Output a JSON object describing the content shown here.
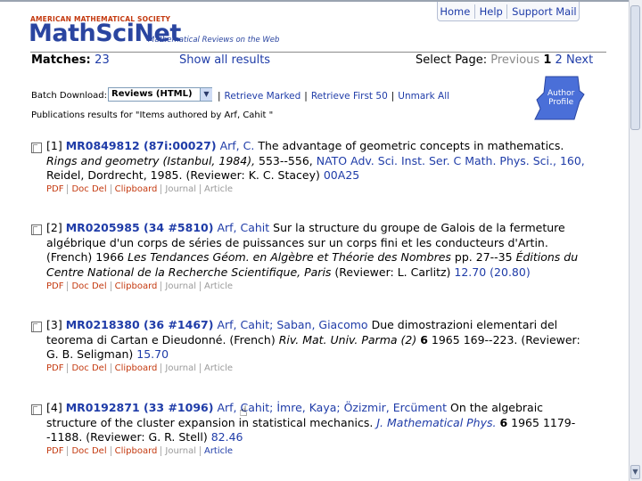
{
  "header": {
    "ams": "AMERICAN MATHEMATICAL SOCIETY",
    "logo": "MathSciNet",
    "tagline": "Mathematical Reviews on the Web",
    "nav": [
      "Home",
      "Help",
      "Support Mail"
    ]
  },
  "results": {
    "matches_label": "Matches:",
    "matches_count": "23",
    "show_all": "Show all results",
    "select_page_label": "Select Page:",
    "previous": "Previous",
    "page1": "1",
    "page2": "2",
    "next": "Next"
  },
  "batch": {
    "label": "Batch Download:",
    "selected": "Reviews (HTML)",
    "links": [
      "Retrieve Marked",
      "Retrieve First 50",
      "Unmark All"
    ],
    "publications_for": "Publications results for \"Items authored by Arf, Cahit \""
  },
  "profile": {
    "line1": "Author",
    "line2": "Profile"
  },
  "entries": [
    {
      "num": "[1]",
      "mr": "MR0849812 (87i:00027)",
      "authors": "Arf, C.",
      "title": "The advantage of geometric concepts in mathematics.",
      "venue": "Rings and geometry (Istanbul, 1984),",
      "pages": "553--556,",
      "series": "NATO Adv. Sci. Inst. Ser. C Math. Phys. Sci., 160,",
      "publisher": "Reidel, Dordrecht,",
      "year": "1985.",
      "reviewer": "(Reviewer: K. C. Stacey)",
      "msc": "00A25",
      "tools": [
        "PDF",
        "Doc Del",
        "Clipboard",
        "Journal",
        "Article"
      ]
    },
    {
      "num": "[2]",
      "mr": "MR0205985 (34 #5810)",
      "authors": "Arf, Cahit",
      "title": "Sur la structure du groupe de Galois de la fermeture algébrique d'un corps de séries de puissances sur un corps fini et les conducteurs d'Artin.",
      "lang": "(French)",
      "year": "1966",
      "venue": "Les Tendances Géom. en Algèbre et Théorie des Nombres",
      "pages": "pp. 27--35",
      "publisher": "Éditions du Centre National de la Recherche Scientifique, Paris",
      "reviewer": "(Reviewer: L. Carlitz)",
      "msc": "12.70 (20.80)",
      "tools": [
        "PDF",
        "Doc Del",
        "Clipboard",
        "Journal",
        "Article"
      ]
    },
    {
      "num": "[3]",
      "mr": "MR0218380 (36 #1467)",
      "authors": "Arf, Cahit; Saban, Giacomo",
      "title": "Due dimostrazioni elementari del teorema di Cartan e Dieudonné.",
      "lang": "(French)",
      "journal": "Riv. Mat. Univ. Parma (2)",
      "volume": "6",
      "year": "1965",
      "pages": "169--223.",
      "reviewer": "(Reviewer: G. B. Seligman)",
      "msc": "15.70",
      "tools": [
        "PDF",
        "Doc Del",
        "Clipboard",
        "Journal",
        "Article"
      ]
    },
    {
      "num": "[4]",
      "mr": "MR0192871 (33 #1096)",
      "authors": "Arf, Cahit; İmre, Kaya; Özizmir, Ercüment",
      "title": "On the algebraic structure of the cluster expansion in statistical mechanics.",
      "journal": "J. Mathematical Phys.",
      "volume": "6",
      "year": "1965",
      "pages": "1179--1188.",
      "reviewer": "(Reviewer: G. R. Stell)",
      "msc": "82.46",
      "tools": [
        "PDF",
        "Doc Del",
        "Clipboard",
        "Journal",
        "Article"
      ]
    }
  ]
}
